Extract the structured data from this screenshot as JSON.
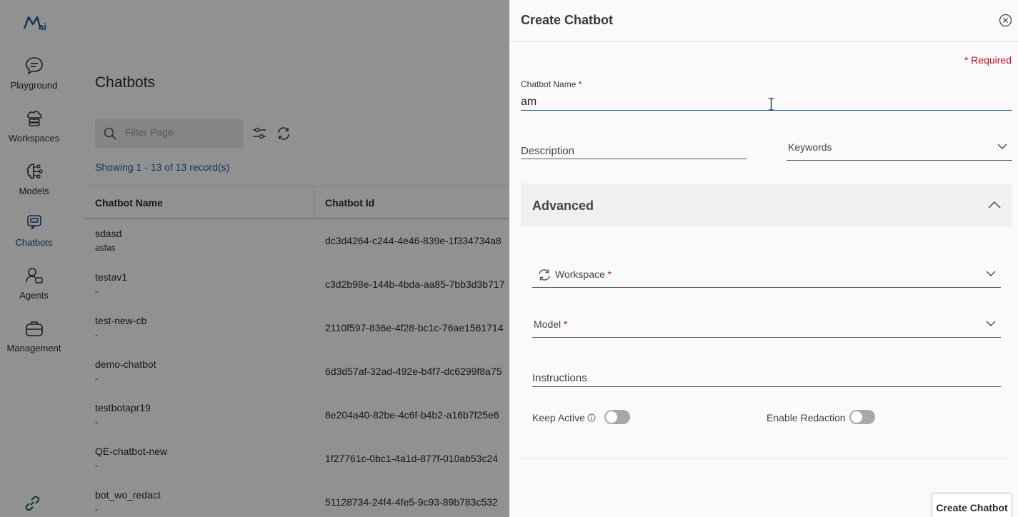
{
  "sidebar": {
    "items": [
      {
        "label": "Playground",
        "icon": "chat-bubble-icon"
      },
      {
        "label": "Workspaces",
        "icon": "cloud-layers-icon"
      },
      {
        "label": "Models",
        "icon": "brain-icon"
      },
      {
        "label": "Chatbots",
        "icon": "chatbot-icon"
      },
      {
        "label": "Agents",
        "icon": "agent-icon"
      },
      {
        "label": "Management",
        "icon": "briefcase-icon"
      }
    ],
    "bottom_icon": "link-icon"
  },
  "main": {
    "title": "Chatbots",
    "filter_placeholder": "Filter Page",
    "records_text": "Showing 1 - 13 of 13 record(s)",
    "columns": [
      "Chatbot Name",
      "Chatbot Id"
    ],
    "rows": [
      {
        "name": "sdasd",
        "desc": "asfas",
        "id": "dc3d4264-c244-4e46-839e-1f334734a8"
      },
      {
        "name": "testav1",
        "desc": "-",
        "id": "c3d2b98e-144b-4bda-aa85-7bb3d3b717"
      },
      {
        "name": "test-new-cb",
        "desc": "-",
        "id": "2110f597-836e-4f28-bc1c-76ae1561714"
      },
      {
        "name": "demo-chatbot",
        "desc": "-",
        "id": "6d3d57af-32ad-492e-b4f7-dc6299f8a75"
      },
      {
        "name": "testbotapr19",
        "desc": "-",
        "id": "8e204a40-82be-4c6f-b4b2-a16b7f25e6"
      },
      {
        "name": "QE-chatbot-new",
        "desc": "-",
        "id": "1f27761c-0bc1-4a1d-877f-010ab53c24"
      },
      {
        "name": "bot_wo_redact",
        "desc": "-",
        "id": "51128734-24f4-4fe5-9c93-89b783c532"
      }
    ]
  },
  "drawer": {
    "title": "Create Chatbot",
    "required_note": "* Required",
    "chatbot_name_label": "Chatbot Name",
    "required_mark": "*",
    "chatbot_name_value": "am",
    "description_label": "Description",
    "keywords_label": "Keywords",
    "advanced_title": "Advanced",
    "workspace_label": "Workspace",
    "model_label": "Model",
    "instructions_label": "Instructions",
    "keep_active_label": "Keep Active",
    "enable_redaction_label": "Enable Redaction",
    "keep_active_on": false,
    "enable_redaction_on": false,
    "create_button": "Create Chatbot"
  },
  "colors": {
    "accent": "#1a5fa8",
    "required": "#c8102e",
    "overlay": "rgba(0,0,0,0.43)"
  }
}
